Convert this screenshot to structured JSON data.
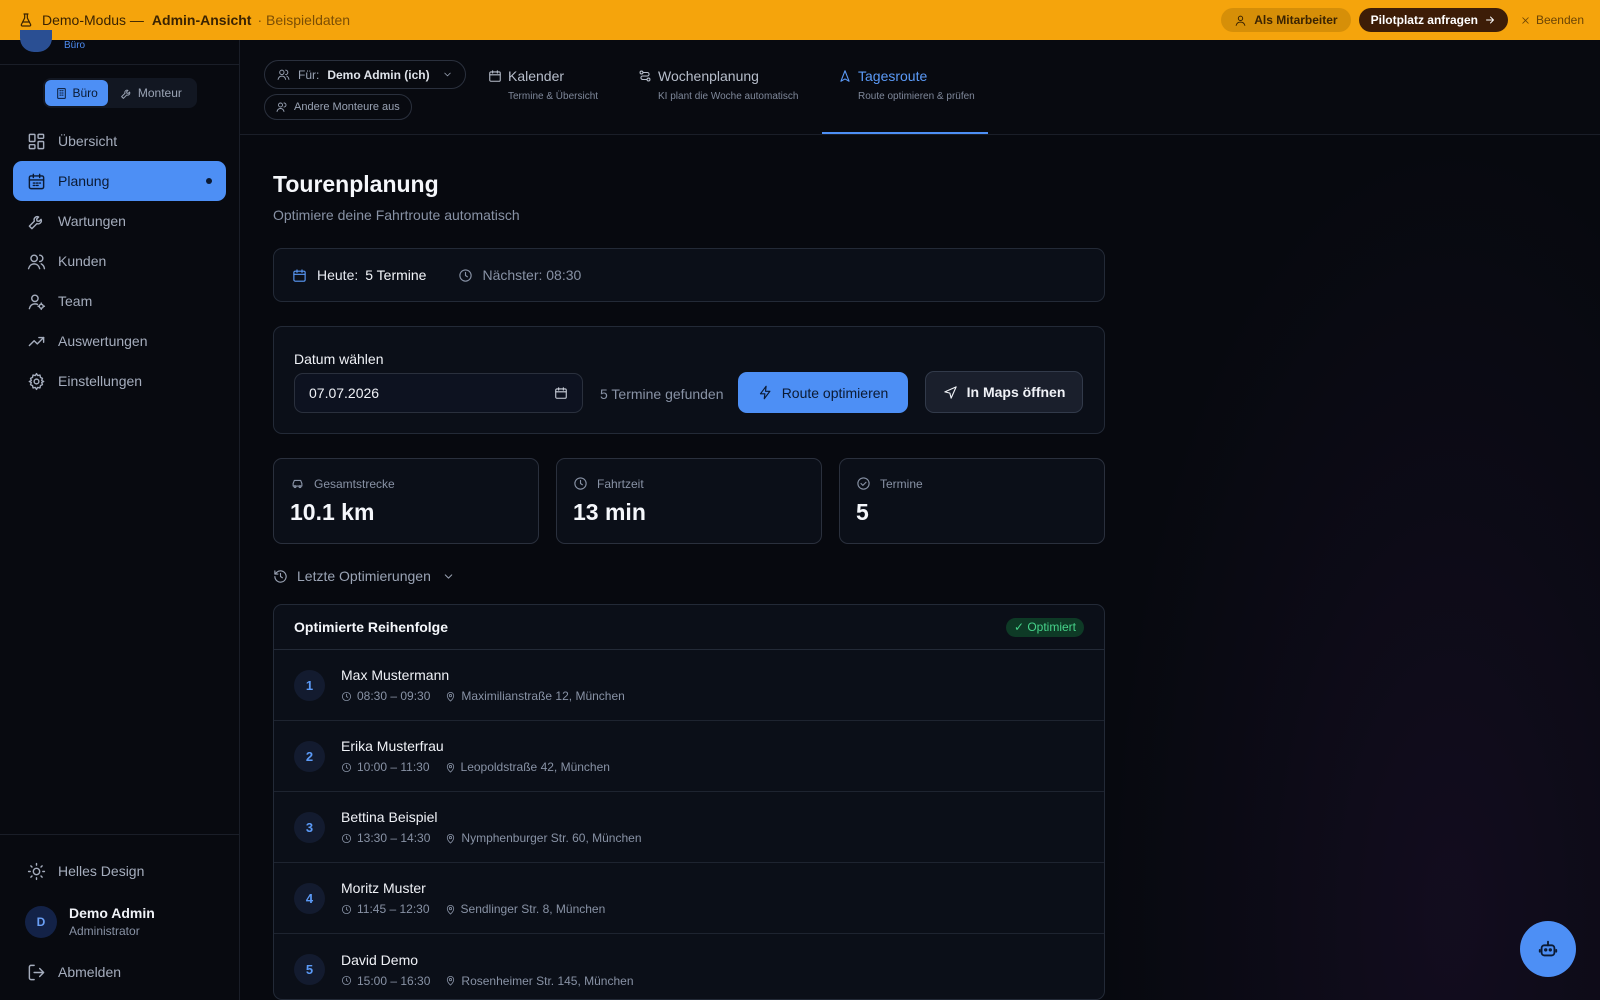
{
  "banner": {
    "mode": "Demo-Modus —",
    "view": "Admin-Ansicht",
    "sample": "· Beispieldaten",
    "employee_button": "Als Mitarbeiter",
    "pilot_button": "Pilotplatz anfragen",
    "end_button": "Beenden",
    "color": "#f5a40c"
  },
  "sidebar": {
    "brand_sub": "Büro",
    "modes": [
      {
        "label": "Büro",
        "icon": "building-icon",
        "active": true
      },
      {
        "label": "Monteur",
        "icon": "wrench-icon",
        "active": false
      }
    ],
    "items": [
      {
        "label": "Übersicht",
        "icon": "dashboard-icon"
      },
      {
        "label": "Planung",
        "icon": "calendar-icon",
        "active": true
      },
      {
        "label": "Wartungen",
        "icon": "wrench-icon"
      },
      {
        "label": "Kunden",
        "icon": "users-icon"
      },
      {
        "label": "Team",
        "icon": "user-gear-icon"
      },
      {
        "label": "Auswertungen",
        "icon": "trend-icon"
      },
      {
        "label": "Einstellungen",
        "icon": "gear-icon"
      }
    ],
    "theme_toggle": "Helles Design",
    "user": {
      "initial": "D",
      "name": "Demo Admin",
      "role": "Administrator"
    },
    "logout": "Abmelden"
  },
  "topbar": {
    "for_label": "Für:",
    "for_value": "Demo Admin (ich)",
    "others": "Andere Monteure aus",
    "tabs": [
      {
        "title": "Kalender",
        "sub": "Termine & Übersicht"
      },
      {
        "title": "Wochenplanung",
        "sub": "KI plant die Woche automatisch"
      },
      {
        "title": "Tagesroute",
        "sub": "Route optimieren & prüfen",
        "active": true
      }
    ]
  },
  "main": {
    "title": "Tourenplanung",
    "subtitle": "Optimiere deine Fahrtroute automatisch",
    "today_label": "Heute:",
    "today_value": "5 Termine",
    "next": "Nächster: 08:30",
    "date_label": "Datum wählen",
    "date_value": "07.07.2026",
    "found": "5 Termine gefunden",
    "route_button": "Route optimieren",
    "maps_button": "In Maps öffnen",
    "stats": [
      {
        "label": "Gesamtstrecke",
        "value": "10.1 km",
        "icon": "car-icon"
      },
      {
        "label": "Fahrtzeit",
        "value": "13 min",
        "icon": "clock-icon"
      },
      {
        "label": "Termine",
        "value": "5",
        "icon": "check-circle-icon"
      }
    ],
    "history": "Letzte Optimierungen",
    "order_title": "Optimierte Reihenfolge",
    "order_badge": "✓ Optimiert",
    "stops": [
      {
        "num": "1",
        "name": "Max Mustermann",
        "time": "08:30 – 09:30",
        "address": "Maximilianstraße 12, München"
      },
      {
        "num": "2",
        "name": "Erika Musterfrau",
        "time": "10:00 – 11:30",
        "address": "Leopoldstraße 42, München"
      },
      {
        "num": "3",
        "name": "Bettina Beispiel",
        "time": "13:30 – 14:30",
        "address": "Nymphenburger Str. 60, München"
      },
      {
        "num": "4",
        "name": "Moritz Muster",
        "time": "11:45 – 12:30",
        "address": "Sendlinger Str. 8, München"
      },
      {
        "num": "5",
        "name": "David Demo",
        "time": "15:00 – 16:30",
        "address": "Rosenheimer Str. 145, München"
      }
    ]
  },
  "colors": {
    "accent": "#4d8ff5",
    "background": "#07090f",
    "success": "#46d38a"
  }
}
